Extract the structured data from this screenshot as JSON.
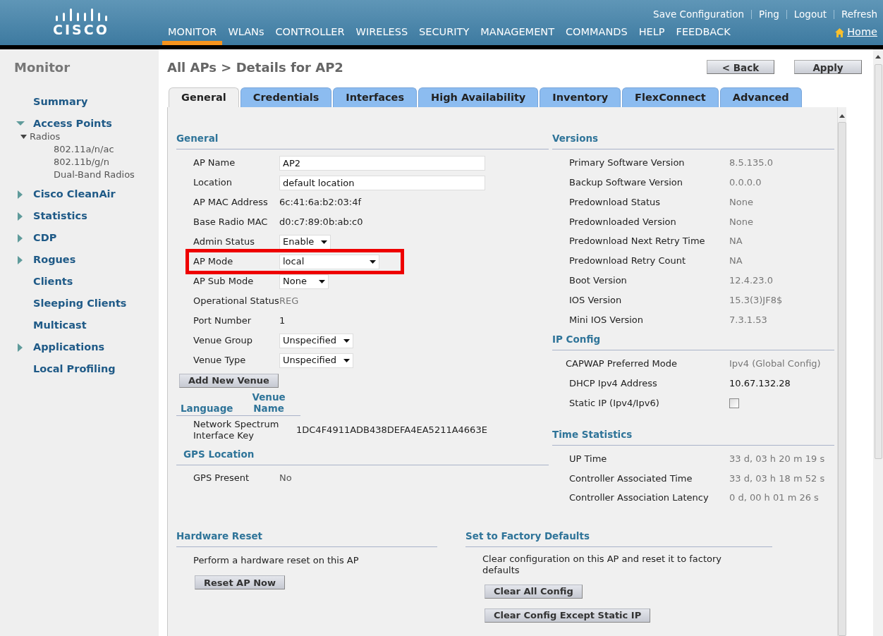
{
  "header": {
    "logo": "CISCO",
    "top_links": [
      "Save Configuration",
      "Ping",
      "Logout",
      "Refresh"
    ],
    "menu": [
      {
        "label": "MONITOR",
        "selected": true
      },
      {
        "label": "WLANs",
        "selected": false
      },
      {
        "label": "CONTROLLER",
        "selected": false
      },
      {
        "label": "WIRELESS",
        "selected": false
      },
      {
        "label": "SECURITY",
        "selected": false
      },
      {
        "label": "MANAGEMENT",
        "selected": false
      },
      {
        "label": "COMMANDS",
        "selected": false
      },
      {
        "label": "HELP",
        "selected": false
      },
      {
        "label": "FEEDBACK",
        "selected": false
      }
    ],
    "home": "Home"
  },
  "sidebar": {
    "title": "Monitor",
    "items": [
      {
        "label": "Summary",
        "kind": "link"
      },
      {
        "label": "Access Points",
        "kind": "expandable",
        "expanded": true,
        "children": [
          {
            "label": "Radios",
            "expanded": true,
            "children": [
              {
                "label": "802.11a/n/ac"
              },
              {
                "label": "802.11b/g/n"
              },
              {
                "label": "Dual-Band Radios"
              }
            ]
          }
        ]
      },
      {
        "label": "Cisco CleanAir",
        "kind": "expandable",
        "expanded": false
      },
      {
        "label": "Statistics",
        "kind": "expandable",
        "expanded": false
      },
      {
        "label": "CDP",
        "kind": "expandable",
        "expanded": false
      },
      {
        "label": "Rogues",
        "kind": "expandable",
        "expanded": false
      },
      {
        "label": "Clients",
        "kind": "link"
      },
      {
        "label": "Sleeping Clients",
        "kind": "link"
      },
      {
        "label": "Multicast",
        "kind": "link"
      },
      {
        "label": "Applications",
        "kind": "expandable",
        "expanded": false
      },
      {
        "label": "Local Profiling",
        "kind": "link"
      }
    ]
  },
  "breadcrumb": "All APs > Details for AP2",
  "buttons": [
    "< Back",
    "Apply"
  ],
  "tabs": [
    {
      "label": "General",
      "selected": true
    },
    {
      "label": "Credentials",
      "selected": false
    },
    {
      "label": "Interfaces",
      "selected": false
    },
    {
      "label": "High Availability",
      "selected": false
    },
    {
      "label": "Inventory",
      "selected": false
    },
    {
      "label": "FlexConnect",
      "selected": false
    },
    {
      "label": "Advanced",
      "selected": false
    }
  ],
  "general": {
    "title": "General",
    "fields": [
      {
        "label": "AP Name",
        "kind": "input",
        "value": "AP2",
        "highlighted": false
      },
      {
        "label": "Location",
        "kind": "input",
        "value": "default location",
        "highlighted": false
      },
      {
        "label": "AP MAC Address",
        "kind": "text",
        "value": "6c:41:6a:b2:03:4f",
        "highlighted": false
      },
      {
        "label": "Base Radio MAC",
        "kind": "text",
        "value": "d0:c7:89:0b:ab:c0",
        "highlighted": false
      },
      {
        "label": "Admin Status",
        "kind": "select",
        "value": "Enable",
        "highlighted": false
      },
      {
        "label": "AP Mode",
        "kind": "select",
        "value": "local",
        "highlighted": true
      },
      {
        "label": "AP Sub Mode",
        "kind": "select",
        "value": "None",
        "highlighted": false
      },
      {
        "label": "Operational Status",
        "kind": "status",
        "value": "REG",
        "highlighted": false
      },
      {
        "label": "Port Number",
        "kind": "text",
        "value": "1",
        "highlighted": false
      },
      {
        "label": "Venue Group",
        "kind": "select",
        "value": "Unspecified",
        "highlighted": false
      },
      {
        "label": "Venue Type",
        "kind": "select",
        "value": "Unspecified",
        "highlighted": false
      }
    ],
    "add_venue": "Add New Venue",
    "venue_columns": [
      "Language",
      "Venue Name"
    ],
    "key_label": "Network Spectrum Interface Key",
    "key_value": "1DC4F4911ADB438DEFA4EA5211A4663E"
  },
  "gps": {
    "title": "GPS Location",
    "label": "GPS Present",
    "value": "No"
  },
  "versions": {
    "title": "Versions",
    "rows": [
      {
        "label": "Primary Software Version",
        "value": "8.5.135.0"
      },
      {
        "label": "Backup Software Version",
        "value": "0.0.0.0"
      },
      {
        "label": "Predownload Status",
        "value": "None"
      },
      {
        "label": "Predownloaded Version",
        "value": "None"
      },
      {
        "label": "Predownload Next Retry Time",
        "value": "NA"
      },
      {
        "label": "Predownload Retry Count",
        "value": "NA"
      },
      {
        "label": "Boot Version",
        "value": "12.4.23.0"
      },
      {
        "label": "IOS Version",
        "value": "15.3(3)JF8$"
      },
      {
        "label": "Mini IOS Version",
        "value": "7.3.1.53"
      }
    ]
  },
  "ip_config": {
    "title": "IP Config",
    "rows": [
      {
        "label": "CAPWAP Preferred Mode",
        "kind": "status",
        "value": "Ipv4 (Global Config)"
      },
      {
        "label": "DHCP Ipv4 Address",
        "kind": "text",
        "value": "10.67.132.28"
      },
      {
        "label": "Static IP (Ipv4/Ipv6)",
        "kind": "checkbox",
        "checked": false
      }
    ]
  },
  "time_statistics": {
    "title": "Time Statistics",
    "rows": [
      {
        "label": "UP Time",
        "value": "33 d, 03 h 20 m 19 s"
      },
      {
        "label": "Controller Associated Time",
        "value": "33 d, 03 h 18 m 52 s"
      },
      {
        "label": "Controller Association Latency",
        "value": "0 d, 00 h 01 m 26 s"
      }
    ]
  },
  "hardware_reset": {
    "title": "Hardware Reset",
    "text": "Perform a hardware reset on this AP",
    "buttons": [
      "Reset AP Now"
    ]
  },
  "factory_defaults": {
    "title": "Set to Factory Defaults",
    "text": "Clear configuration on this AP and reset it to factory defaults",
    "buttons": [
      "Clear All Config",
      "Clear Config Except Static IP"
    ]
  }
}
